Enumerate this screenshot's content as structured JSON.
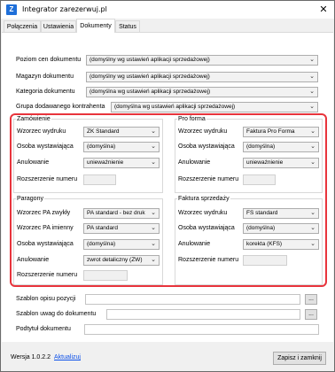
{
  "window": {
    "title": "Integrator zarezerwuj.pl",
    "icon_letter": "Z"
  },
  "tabs": [
    {
      "label": "Połączenia"
    },
    {
      "label": "Ustawienia"
    },
    {
      "label": "Dokumenty",
      "active": true
    },
    {
      "label": "Status"
    }
  ],
  "top_fields": [
    {
      "label": "Poziom cen dokumentu",
      "value": "(domyślny wg ustawień aplikacji sprzedażowej)"
    },
    {
      "label": "Magazyn dokumentu",
      "value": "(domyślny wg ustawień aplikacji sprzedażowej)"
    },
    {
      "label": "Kategoria dokumentu",
      "value": "(domyślna wg ustawień aplikacji sprzedażowej)"
    },
    {
      "label": "Grupa dodawanego kontrahenta",
      "value": "(domyślna wg ustawień aplikacji sprzedażowej)"
    }
  ],
  "zamowienie": {
    "title": "Zamówienie",
    "wzorzec_label": "Wzorzec wydruku",
    "wzorzec_value": "ZK Standard",
    "osoba_label": "Osoba wystawiająca",
    "osoba_value": "(domyślna)",
    "anulowanie_label": "Anulowanie",
    "anulowanie_value": "unieważnienie",
    "rozszerzenie_label": "Rozszerzenie numeru"
  },
  "proforma": {
    "title": "Pro forma",
    "wzorzec_label": "Wzorzec wydruku",
    "wzorzec_value": "Faktura Pro Forma",
    "osoba_label": "Osoba wystawiająca",
    "osoba_value": "(domyślna)",
    "anulowanie_label": "Anulowanie",
    "anulowanie_value": "unieważnienie",
    "rozszerzenie_label": "Rozszerzenie numeru"
  },
  "paragony": {
    "title": "Paragony",
    "pa_zwykly_label": "Wzorzec PA zwykły",
    "pa_zwykly_value": "PA standard - bez druk",
    "pa_imienny_label": "Wzorzec PA imienny",
    "pa_imienny_value": "PA standard",
    "osoba_label": "Osoba wystawiająca",
    "osoba_value": "(domyślna)",
    "anulowanie_label": "Anulowanie",
    "anulowanie_value": "zwrot detaliczny (ZW)",
    "rozszerzenie_label": "Rozszerzenie numeru"
  },
  "faktura": {
    "title": "Faktura sprzedaży",
    "wzorzec_label": "Wzorzec wydruku",
    "wzorzec_value": "FS standard",
    "osoba_label": "Osoba wystawiająca",
    "osoba_value": "(domyślna)",
    "anulowanie_label": "Anulowanie",
    "anulowanie_value": "korekta (KFS)",
    "rozszerzenie_label": "Rozszerzenie numeru"
  },
  "bottom_fields": {
    "szablon_opisu_label": "Szablon opisu pozycji",
    "szablon_uwag_label": "Szablon uwag do dokumentu",
    "podtytul_label": "Podtytuł dokumentu",
    "browse_label": "..."
  },
  "footer": {
    "version": "Wersja 1.0.2.2",
    "update_link": "Aktualizuj",
    "save_close": "Zapisz i zamknij"
  },
  "icons": {
    "dropdown": "chevron-down-icon",
    "close": "close-icon"
  },
  "colors": {
    "highlight": "#e8343c",
    "link": "#0b4fe8",
    "app_icon": "#1e6fd9"
  }
}
